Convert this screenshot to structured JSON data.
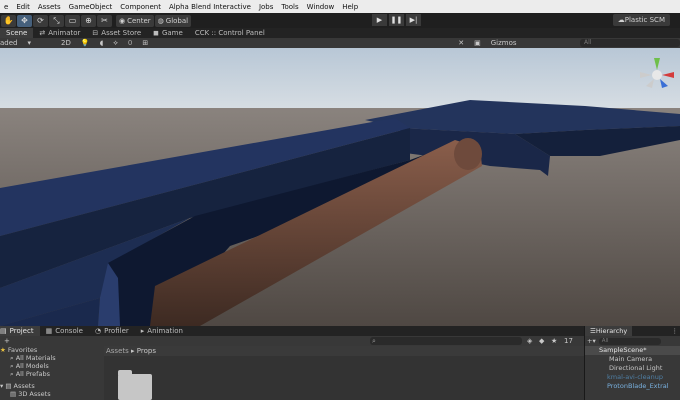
{
  "menu": [
    "e",
    "Edit",
    "Assets",
    "GameObject",
    "Component",
    "Alpha Blend Interactive",
    "Jobs",
    "Tools",
    "Window",
    "Help"
  ],
  "toolbar": {
    "tools": [
      "hand-icon",
      "move-icon",
      "rotate-icon",
      "scale-icon",
      "rect-icon",
      "transform-icon",
      "custom-tool-icon"
    ],
    "pivot": "Center",
    "space": "Global",
    "plastic": "Plastic SCM"
  },
  "tabs": [
    "Scene",
    "Animator",
    "Asset Store",
    "Game",
    "CCK :: Control Panel"
  ],
  "scenebar": {
    "shading": "aded",
    "mode": "2D",
    "gizmos": "Gizmos",
    "search_placeholder": "All",
    "hidden_count": "0"
  },
  "project": {
    "tabs": [
      "Project",
      "Console",
      "Profiler",
      "Animation"
    ],
    "favorites_label": "Favorites",
    "favorites": [
      "All Materials",
      "All Models",
      "All Prefabs"
    ],
    "assets_label": "Assets",
    "assets_children": [
      "3D Assets"
    ],
    "breadcrumb": [
      "Assets",
      "Props"
    ],
    "count": "17"
  },
  "hierarchy": {
    "title": "Hierarchy",
    "search_placeholder": "All",
    "scene": "SampleScene*",
    "items": [
      {
        "name": "Main Camera",
        "style": "normal"
      },
      {
        "name": "Directional Light",
        "style": "normal"
      },
      {
        "name": "kmal-avi-cleanup",
        "style": "dimmed"
      },
      {
        "name": "ProtonBlade_Extral",
        "style": "blue"
      }
    ]
  },
  "colors": {
    "accent": "#46607c",
    "sky_top": "#c9d6e2",
    "ground": "#5d5550",
    "blade": "#1c2a4d",
    "grip": "#5a3d34"
  }
}
